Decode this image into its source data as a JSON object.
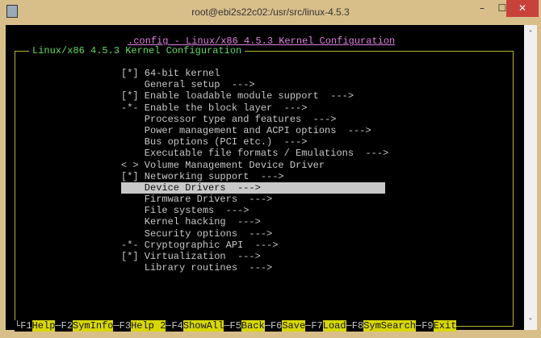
{
  "window": {
    "title": "root@ebi2s22c02:/usr/src/linux-4.5.3",
    "minimize": "–",
    "maximize": "☐",
    "close": "✕"
  },
  "header": ".config - Linux/x86 4.5.3 Kernel Configuration",
  "box_title": "Linux/x86 4.5.3 Kernel Configuration",
  "menu": [
    "[*] 64-bit kernel",
    "    General setup  --->",
    "[*] Enable loadable module support  --->",
    "-*- Enable the block layer  --->",
    "    Processor type and features  --->",
    "    Power management and ACPI options  --->",
    "    Bus options (PCI etc.)  --->",
    "    Executable file formats / Emulations  --->",
    "< > Volume Management Device Driver",
    "[*] Networking support  --->",
    "    Device Drivers  --->",
    "    Firmware Drivers  --->",
    "    File systems  --->",
    "    Kernel hacking  --->",
    "    Security options  --->",
    "-*- Cryptographic API  --->",
    "[*] Virtualization  --->",
    "    Library routines  --->"
  ],
  "selected_index": 10,
  "fkeys": [
    {
      "key": "F1",
      "label": "Help"
    },
    {
      "key": "F2",
      "label": "SymInfo"
    },
    {
      "key": "F3",
      "label": "Help 2"
    },
    {
      "key": "F4",
      "label": "ShowAll"
    },
    {
      "key": "F5",
      "label": "Back"
    },
    {
      "key": "F6",
      "label": "Save"
    },
    {
      "key": "F7",
      "label": "Load"
    },
    {
      "key": "F8",
      "label": "SymSearch"
    },
    {
      "key": "F9",
      "label": "Exit"
    }
  ],
  "scrollbar": {
    "up": "˄",
    "down": "˅"
  }
}
